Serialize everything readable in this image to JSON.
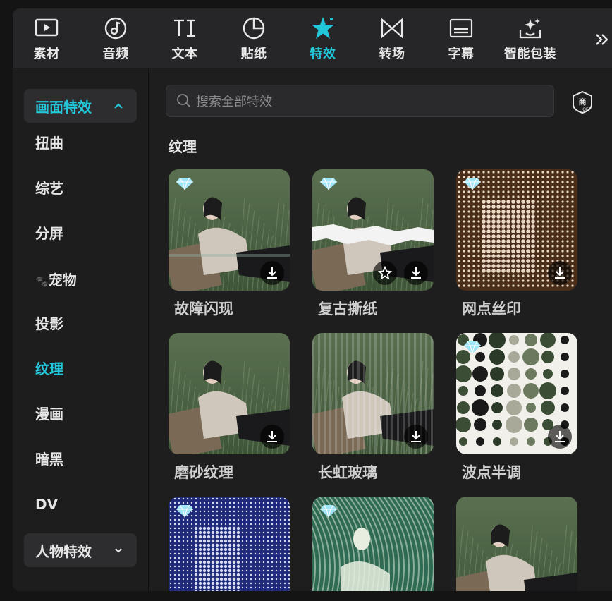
{
  "tabs": [
    {
      "label": "素材",
      "icon": "media-play-icon"
    },
    {
      "label": "音频",
      "icon": "music-note-icon"
    },
    {
      "label": "文本",
      "icon": "text-ti-icon"
    },
    {
      "label": "贴纸",
      "icon": "sticker-icon"
    },
    {
      "label": "特效",
      "icon": "effects-star-icon",
      "active": true
    },
    {
      "label": "转场",
      "icon": "transition-bowtie-icon"
    },
    {
      "label": "字幕",
      "icon": "subtitle-icon"
    },
    {
      "label": "智能包装",
      "icon": "smart-package-icon"
    }
  ],
  "accent": "#22c7d9",
  "sidebar": {
    "group_open": "画面特效",
    "items": [
      "扭曲",
      "综艺",
      "分屏",
      "宠物",
      "投影",
      "纹理",
      "漫画",
      "暗黑",
      "DV"
    ],
    "active_item": "纹理",
    "pet_emoji": "🐾",
    "group_closed": "人物特效"
  },
  "search": {
    "placeholder": "搜索全部特效"
  },
  "section": {
    "title": "纹理"
  },
  "cards": [
    {
      "name": "故障闪现",
      "premium": true,
      "favorite": false
    },
    {
      "name": "复古撕纸",
      "premium": true,
      "favorite": true
    },
    {
      "name": "网点丝印",
      "premium": true,
      "favorite": false
    },
    {
      "name": "磨砂纹理",
      "premium": false,
      "favorite": false
    },
    {
      "name": "长虹玻璃",
      "premium": false,
      "favorite": false
    },
    {
      "name": "波点半调",
      "premium": true,
      "favorite": false
    },
    {
      "name": "",
      "premium": true,
      "favorite": false
    },
    {
      "name": "",
      "premium": true,
      "favorite": false
    },
    {
      "name": "",
      "premium": false,
      "favorite": false
    }
  ]
}
